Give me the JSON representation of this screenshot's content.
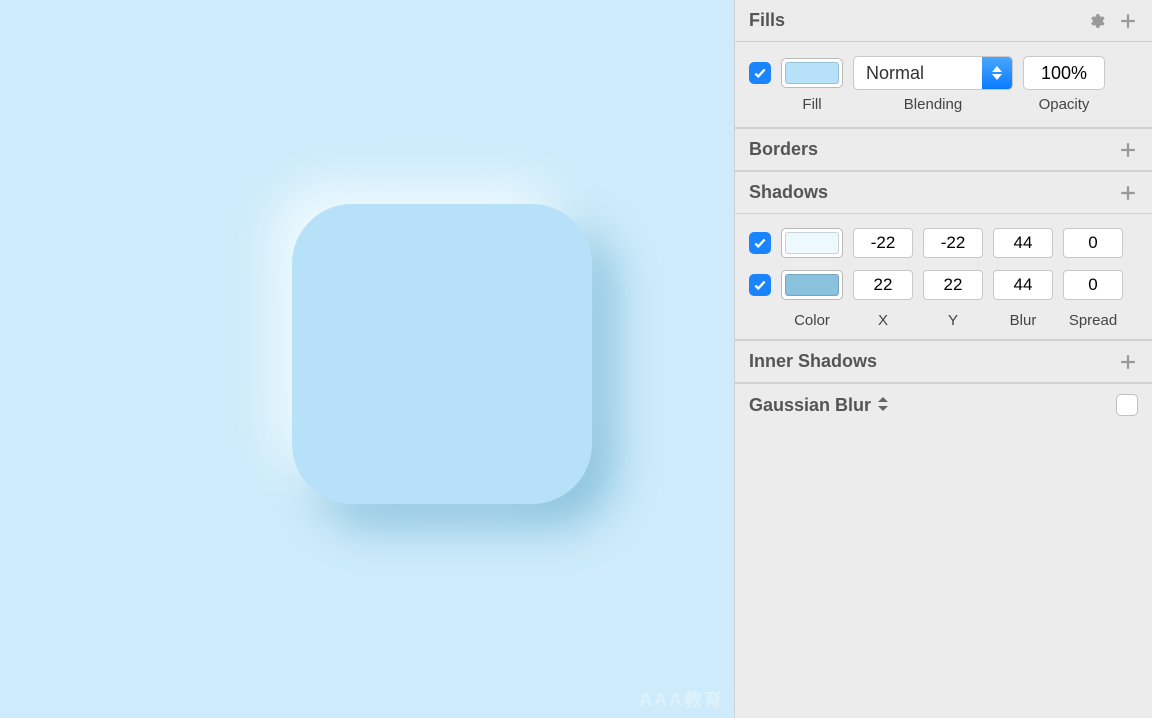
{
  "canvas": {
    "bg": "#cdebfa",
    "shape": {
      "fill": "#b7e1f9",
      "radius": 60
    }
  },
  "panel": {
    "fills": {
      "title": "Fills",
      "enabled": true,
      "swatch": "#b7e1f9",
      "blending": "Normal",
      "opacity": "100%",
      "labels": {
        "fill": "Fill",
        "blending": "Blending",
        "opacity": "Opacity"
      }
    },
    "borders": {
      "title": "Borders"
    },
    "shadows": {
      "title": "Shadows",
      "items": [
        {
          "enabled": true,
          "color": "#edf9fe",
          "x": "-22",
          "y": "-22",
          "blur": "44",
          "spread": "0"
        },
        {
          "enabled": true,
          "color": "#8ac2de",
          "x": "22",
          "y": "22",
          "blur": "44",
          "spread": "0"
        }
      ],
      "labels": {
        "color": "Color",
        "x": "X",
        "y": "Y",
        "blur": "Blur",
        "spread": "Spread"
      }
    },
    "innerShadows": {
      "title": "Inner Shadows"
    },
    "gaussian": {
      "title": "Gaussian Blur",
      "enabled": false
    }
  },
  "watermark": "AAA教育"
}
